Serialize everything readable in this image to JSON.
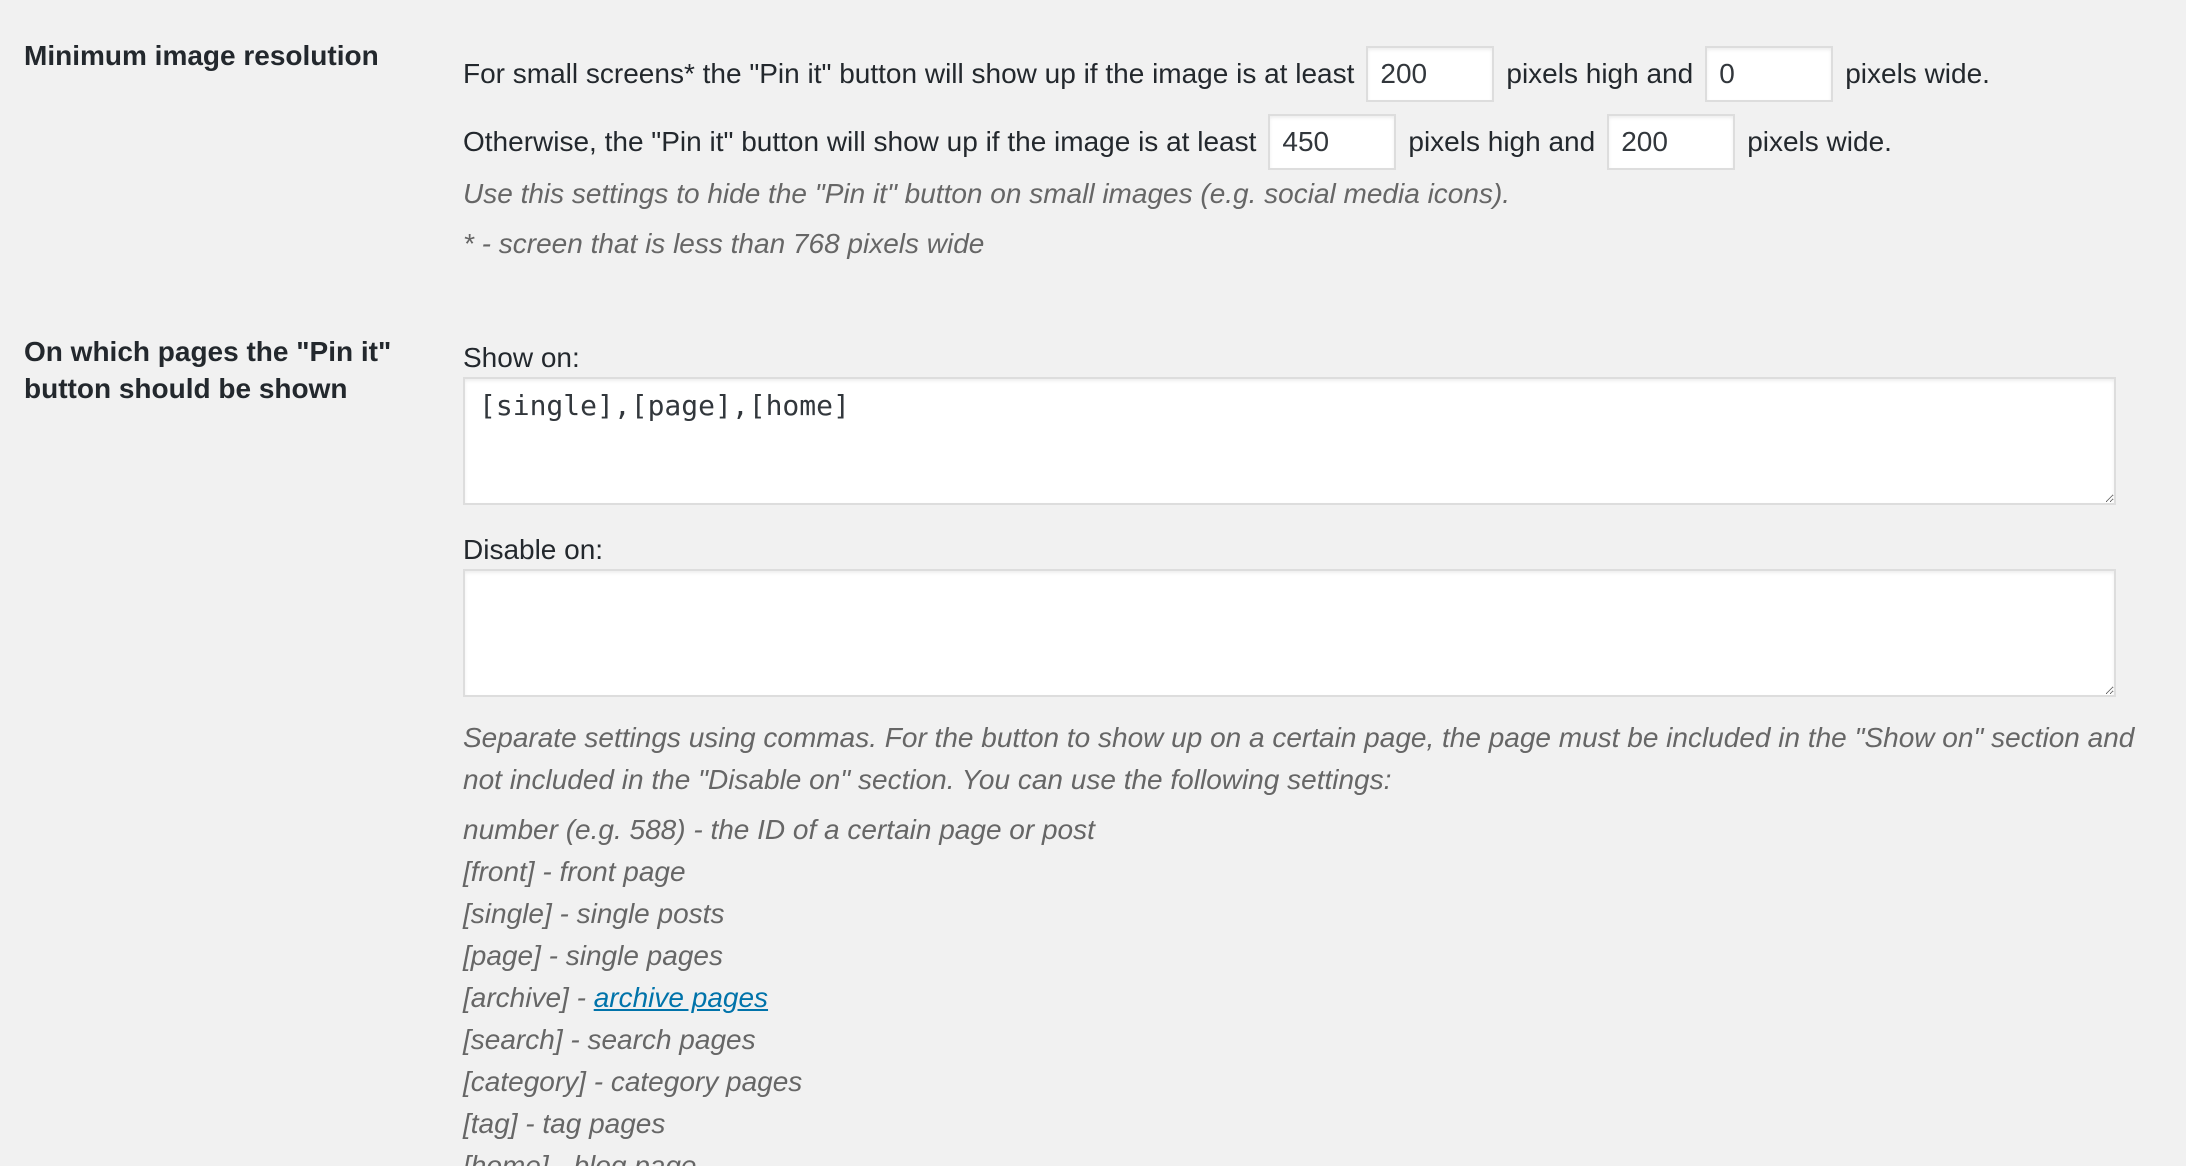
{
  "min_resolution": {
    "label": "Minimum image resolution",
    "small_screens": {
      "prefix": "For small screens* the \"Pin it\" button will show up if the image is at least",
      "high_value": "200",
      "middle": "pixels high and",
      "wide_value": "0",
      "suffix": "pixels wide."
    },
    "otherwise": {
      "prefix": "Otherwise, the \"Pin it\" button will show up if the image is at least",
      "high_value": "450",
      "middle": "pixels high and",
      "wide_value": "200",
      "suffix": "pixels wide."
    },
    "description": "Use this settings to hide the \"Pin it\" button on small images (e.g. social media icons).",
    "footnote": "* - screen that is less than 768 pixels wide"
  },
  "pages": {
    "label_line1": "On which pages the \"Pin it\"",
    "label_line2": "button should be shown",
    "show_on_label": "Show on:",
    "show_on_value": "[single],[page],[home]",
    "disable_on_label": "Disable on:",
    "disable_on_value": "",
    "help_text": "Separate settings using commas. For the button to show up on a certain page, the page must be included in the \"Show on\" section and not included in the \"Disable on\" section. You can use the following settings:",
    "options": [
      {
        "text": "number (e.g. 588) - the ID of a certain page or post"
      },
      {
        "text": "[front] - front page"
      },
      {
        "text": "[single] - single posts"
      },
      {
        "text": "[page] - single pages"
      },
      {
        "prefix": "[archive] - ",
        "link": "archive pages"
      },
      {
        "text": "[search] - search pages"
      },
      {
        "text": "[category] - category pages"
      },
      {
        "text": "[tag] - tag pages"
      },
      {
        "text": "[home] - blog page"
      }
    ]
  }
}
